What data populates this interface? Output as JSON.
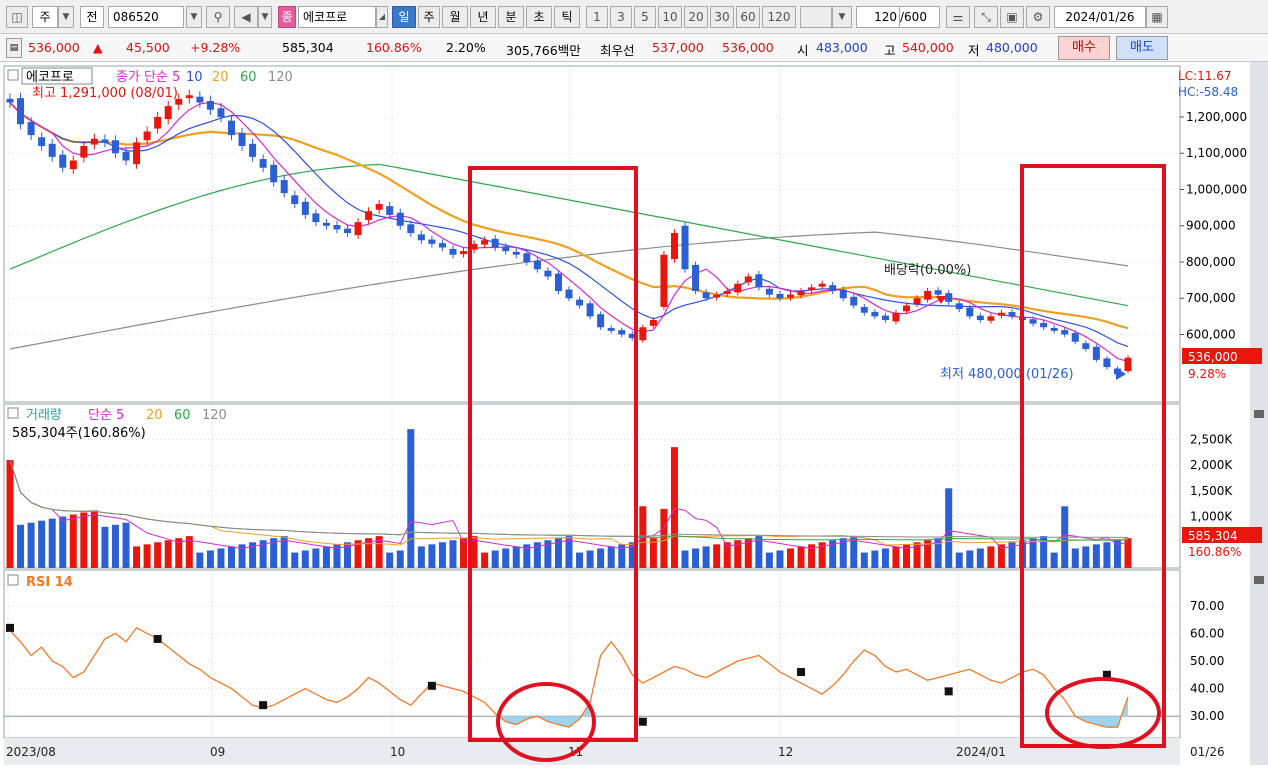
{
  "toolbar": {
    "market": "주",
    "jeon": "전",
    "code": "086520",
    "badge": "종",
    "name": "에코프로",
    "periods": [
      "일",
      "주",
      "월",
      "년",
      "분",
      "초",
      "틱"
    ],
    "minutes": [
      "1",
      "3",
      "5",
      "10",
      "20",
      "30",
      "60",
      "120"
    ],
    "count": "120",
    "count_total": "/600",
    "date": "2024/01/26"
  },
  "quote": {
    "price": "536,000",
    "change_arrow": "▲",
    "change": "45,500",
    "change_pct": "+9.28%",
    "volume": "585,304",
    "vol_ratio": "160.86%",
    "turnover": "2.20%",
    "amount": "305,766백만",
    "best_label": "최우선",
    "best_ask": "537,000",
    "best_bid": "536,000",
    "open_label": "시",
    "open": "483,000",
    "high_label": "고",
    "high": "540,000",
    "low_label": "저",
    "low": "480,000",
    "buy": "매수",
    "sell": "매도"
  },
  "price_panel": {
    "name_tag": "에코프로",
    "legend_main": "종가 단순 5",
    "ma_periods": [
      "10",
      "20",
      "60",
      "120"
    ],
    "high_note": "최고 1,291,000 (08/01)",
    "low_note": "최저 480,000 (01/26)",
    "dividend_note": "배당락(0.00%)",
    "lc": "LC:11.67",
    "hc": "HC:-58.48",
    "yticks": [
      "1,200,000",
      "1,100,000",
      "1,000,000",
      "900,000",
      "800,000",
      "700,000",
      "600,000"
    ],
    "last_price": "536,000",
    "last_pct": "9.28%"
  },
  "volume_panel": {
    "title": "거래량",
    "legend_main": "단순 5",
    "ma_periods": [
      "20",
      "60",
      "120"
    ],
    "vol_note": "585,304주(160.86%)",
    "yticks": [
      "2,500K",
      "2,000K",
      "1,500K",
      "1,000K"
    ],
    "last_vol": "585,304",
    "last_pct": "160.86%"
  },
  "rsi_panel": {
    "title": "RSI 14",
    "yticks": [
      "70.00",
      "60.00",
      "50.00",
      "40.00",
      "30.00"
    ]
  },
  "xaxis": {
    "labels": [
      "2023/08",
      "09",
      "10",
      "11",
      "12",
      "2024/01"
    ],
    "last": "01/26"
  },
  "colors": {
    "up": "#e8160c",
    "down": "#2a5fd6",
    "ma5": "#d52ad2",
    "ma10": "#2b52e0",
    "ma20": "#f0a020",
    "ma60": "#2ea84a",
    "ma120": "#8c8c8c",
    "rsi": "#f07a28",
    "highlight": "#e01020"
  },
  "chart_data": {
    "type": "candlestick",
    "title": "에코프로",
    "period": "daily",
    "x_start": "2023/08/01",
    "x_end": "2024/01/26",
    "close_series_approx": [
      1240000,
      1180000,
      1150000,
      1120000,
      1090000,
      1060000,
      1080000,
      1120000,
      1140000,
      1130000,
      1100000,
      1080000,
      1130000,
      1160000,
      1200000,
      1230000,
      1250000,
      1260000,
      1240000,
      1220000,
      1200000,
      1150000,
      1120000,
      1090000,
      1060000,
      1020000,
      990000,
      960000,
      930000,
      910000,
      900000,
      890000,
      880000,
      910000,
      940000,
      960000,
      930000,
      900000,
      880000,
      860000,
      850000,
      840000,
      820000,
      830000,
      850000,
      860000,
      840000,
      830000,
      820000,
      800000,
      780000,
      760000,
      720000,
      700000,
      680000,
      650000,
      620000,
      610000,
      600000,
      590000,
      620000,
      640000,
      820000,
      880000,
      780000,
      720000,
      700000,
      710000,
      720000,
      740000,
      760000,
      730000,
      710000,
      700000,
      710000,
      720000,
      730000,
      740000,
      720000,
      700000,
      680000,
      660000,
      650000,
      640000,
      660000,
      680000,
      700000,
      720000,
      710000,
      690000,
      670000,
      650000,
      640000,
      650000,
      660000,
      650000,
      640000,
      630000,
      620000,
      610000,
      600000,
      580000,
      560000,
      530000,
      510000,
      490000,
      536000
    ],
    "ma_periods": [
      5,
      10,
      20,
      60,
      120
    ],
    "price_ylim": [
      480000,
      1291000
    ],
    "highest": {
      "value": 1291000,
      "date": "08/01"
    },
    "lowest": {
      "value": 480000,
      "date": "01/26"
    },
    "last": {
      "close": 536000,
      "change_pct": 9.28,
      "volume": 585304
    },
    "volume_yticks_k": [
      1000,
      1500,
      2000,
      2500
    ],
    "rsi": {
      "period": 14,
      "ylim": [
        25,
        75
      ],
      "oversold": 30
    }
  }
}
